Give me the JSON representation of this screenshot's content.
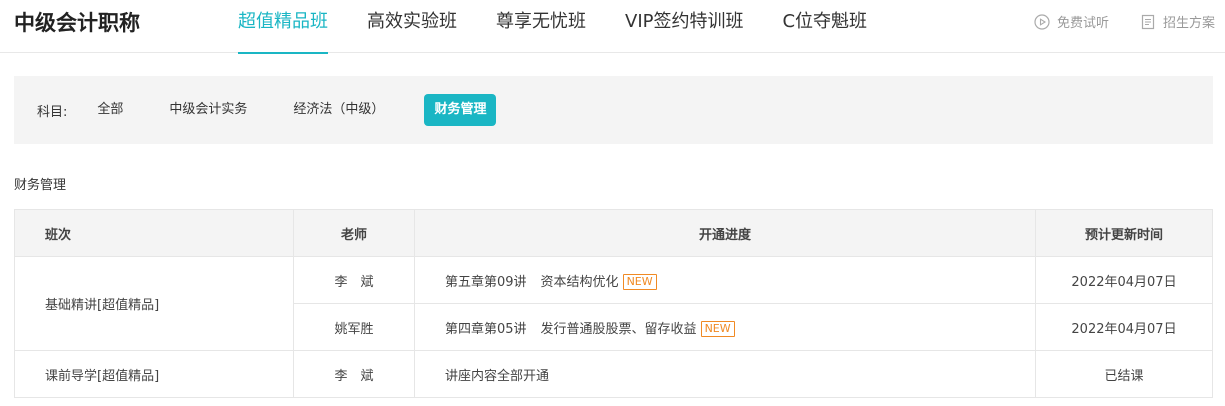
{
  "brand": "中级会计职称",
  "nav": {
    "tabs": [
      {
        "label": "超值精品班",
        "active": true
      },
      {
        "label": "高效实验班",
        "active": false
      },
      {
        "label": "尊享无忧班",
        "active": false
      },
      {
        "label": "VIP签约特训班",
        "active": false
      },
      {
        "label": "C位夺魁班",
        "active": false
      }
    ]
  },
  "tools": {
    "trial": {
      "label": "免费试听",
      "icon": "play-circle-icon"
    },
    "plan": {
      "label": "招生方案",
      "icon": "document-icon"
    }
  },
  "filter": {
    "label": "科目:",
    "chips": [
      {
        "label": "全部",
        "active": false
      },
      {
        "label": "中级会计实务",
        "active": false
      },
      {
        "label": "经济法（中级）",
        "active": false
      },
      {
        "label": "财务管理",
        "active": true
      }
    ]
  },
  "section_title": "财务管理",
  "table": {
    "headers": [
      "班次",
      "老师",
      "开通进度",
      "预计更新时间"
    ],
    "groups": [
      {
        "class_name": "基础精讲[超值精品]",
        "rows": [
          {
            "teacher": "李　斌",
            "lesson": "第五章第09讲",
            "topic": "资本结构优化",
            "badge": "NEW",
            "update": "2022年04月07日"
          },
          {
            "teacher": "姚军胜",
            "lesson": "第四章第05讲",
            "topic": "发行普通股股票、留存收益",
            "badge": "NEW",
            "update": "2022年04月07日"
          }
        ]
      },
      {
        "class_name": "课前导学[超值精品]",
        "rows": [
          {
            "teacher": "李　斌",
            "lesson": "讲座内容全部开通",
            "topic": "",
            "badge": "",
            "update": "已结课"
          }
        ]
      }
    ]
  },
  "colors": {
    "accent": "#1ab6c4",
    "badge": "#f08a24"
  }
}
